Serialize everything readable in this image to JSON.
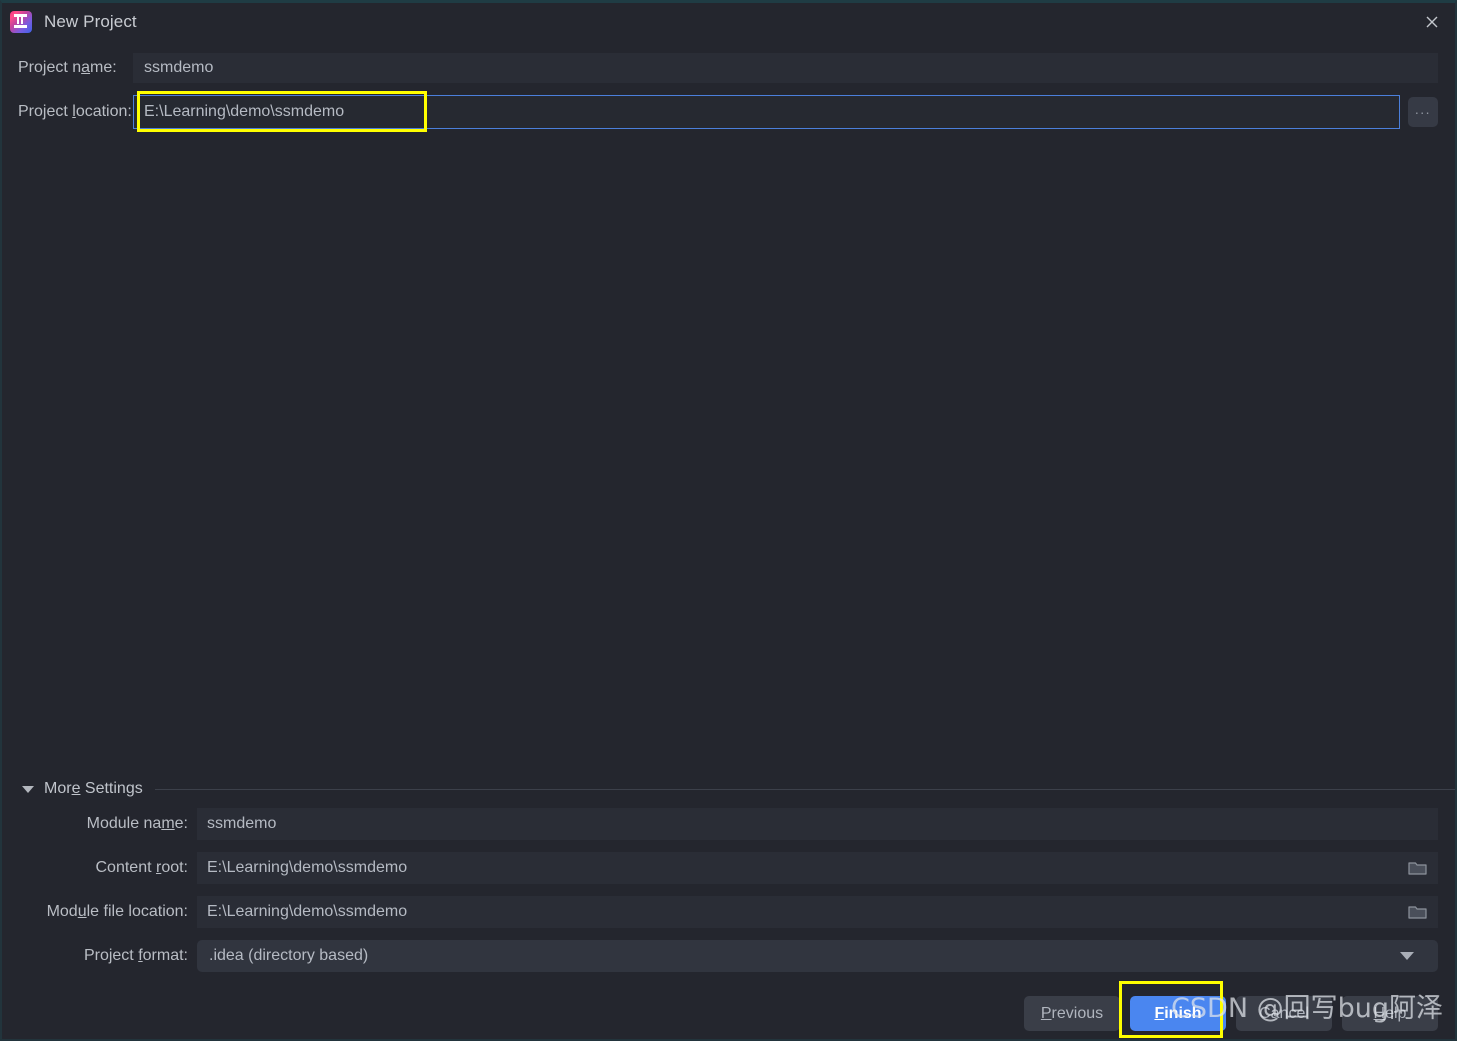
{
  "window": {
    "title": "New Project",
    "logo_icon": "intellij-idea-logo",
    "close_icon": "close-icon"
  },
  "form": {
    "project_name": {
      "label": "Project name:",
      "value": "ssmdemo",
      "mnemonic_index": 10
    },
    "project_location": {
      "label": "Project location:",
      "value": "E:\\Learning\\demo\\ssmdemo",
      "browse_label": "...",
      "browse_icon": "ellipsis-icon"
    }
  },
  "more_settings": {
    "label": "More Settings",
    "expanded": true,
    "arrow_icon": "chevron-down-icon",
    "fields": [
      {
        "label": "Module name:",
        "value": "ssmdemo",
        "type": "text"
      },
      {
        "label": "Content root:",
        "value": "E:\\Learning\\demo\\ssmdemo",
        "type": "text-with-browse",
        "browse_icon": "folder-icon"
      },
      {
        "label": "Module file location:",
        "value": "E:\\Learning\\demo\\ssmdemo",
        "type": "text-with-browse",
        "browse_icon": "folder-icon"
      },
      {
        "label": "Project format:",
        "value": ".idea (directory based)",
        "type": "combobox",
        "arrow_icon": "chevron-down-icon"
      }
    ]
  },
  "buttons": {
    "previous": "Previous",
    "finish": "Finish",
    "cancel": "Cancel",
    "help": "Help"
  },
  "annotations": {
    "highlight_color": "#ffff00",
    "targets": [
      "project-location-input",
      "finish-button"
    ]
  },
  "watermark": {
    "text": "CSDN @回写bug阿泽"
  },
  "colors": {
    "dialog_background": "#24262e",
    "field_background": "#2a2d36",
    "accent_blue": "#4a86f0",
    "focus_border": "#4b7fdb",
    "text": "#b9bdc4",
    "window_border": "#1f3c44"
  }
}
